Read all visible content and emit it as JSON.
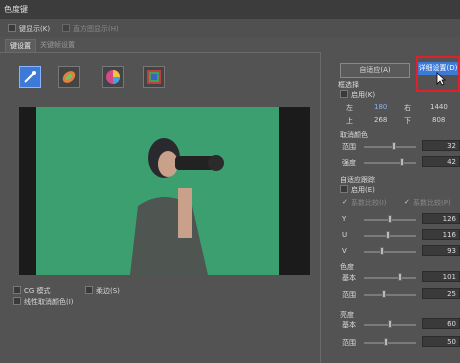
{
  "window": {
    "title": "色度键"
  },
  "top": {
    "show_key_label": "键显示(K)",
    "show_histogram_label": "直方图显示(H)"
  },
  "tabs": [
    {
      "label": "键设置"
    },
    {
      "label": "关键帧设置"
    }
  ],
  "tools": [
    {
      "icon": "eyedropper-icon"
    },
    {
      "icon": "color-wheel-leaf-icon"
    },
    {
      "icon": "color-wheel-pie-icon"
    },
    {
      "icon": "color-square-icon"
    }
  ],
  "buttons": {
    "auto": "自适应(A)",
    "detail": "详细设置(D)"
  },
  "frame": {
    "title": "框选择",
    "enable_label": "启用(K)",
    "left_label": "左",
    "left_value": "180",
    "right_label": "右",
    "right_value": "1440",
    "top_label": "上",
    "top_value": "268",
    "bottom_label": "下",
    "bottom_value": "808"
  },
  "key_color": {
    "title": "取消颜色",
    "range_label": "范围",
    "range_value": "32",
    "strength_label": "强度",
    "strength_value": "42"
  },
  "adaptive": {
    "title": "自适应跟踪",
    "enable_label": "启用(E)",
    "opt1_label": "系数比较(I)",
    "opt2_label": "系数比较(P)"
  },
  "yuv": [
    {
      "label": "Y",
      "value": "126"
    },
    {
      "label": "U",
      "value": "116"
    },
    {
      "label": "V",
      "value": "93"
    }
  ],
  "chroma": {
    "title": "色度",
    "base_label": "基本",
    "base_value": "101",
    "range_label": "范围",
    "range_value": "25"
  },
  "luma": {
    "title": "亮度",
    "base_label": "基本",
    "base_value": "60",
    "range_label": "范围",
    "range_value": "50"
  },
  "bottom": {
    "cg_label": "CG 模式",
    "soft_label": "柔边(S)",
    "linear_label": "线性取消颜色(I)"
  },
  "colors": {
    "accent": "#3d7ad8",
    "highlight": "#e0202a",
    "green_screen": "#3c9f70"
  }
}
